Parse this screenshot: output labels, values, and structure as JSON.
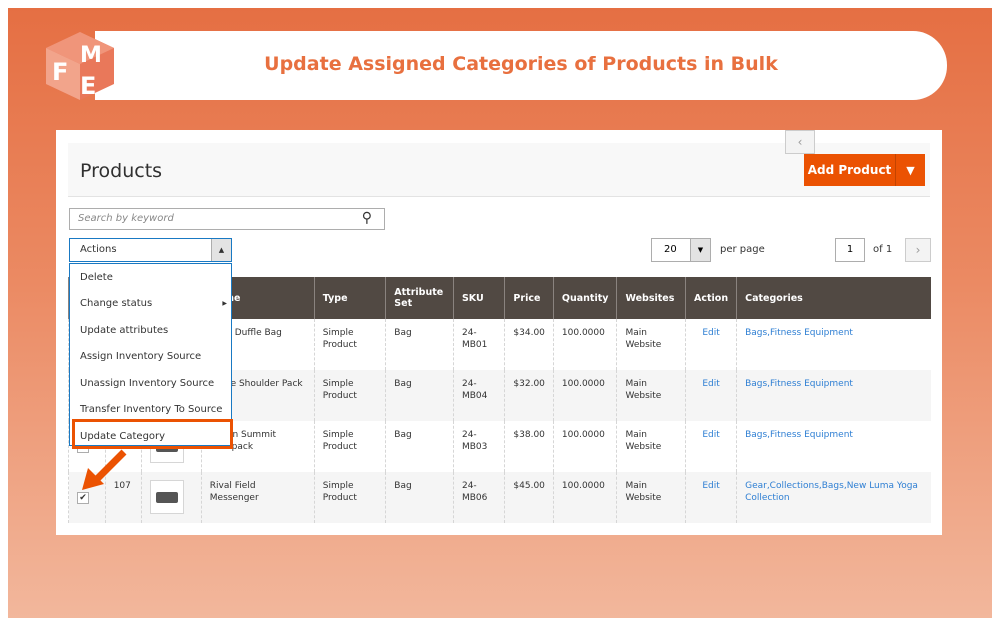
{
  "banner": {
    "title": "Update Assigned Categories of Products in Bulk",
    "logo_text": "FME"
  },
  "page": {
    "title": "Products",
    "add_product": "Add Product"
  },
  "search": {
    "placeholder": "Search by keyword"
  },
  "actions": {
    "label": "Actions",
    "items": [
      "Delete",
      "Change status",
      "Update attributes",
      "Assign Inventory Source",
      "Unassign Inventory Source",
      "Transfer Inventory To Source",
      "Update Category"
    ],
    "highlighted": "Update Category"
  },
  "pager": {
    "per_page_value": "20",
    "per_page_label": "per page",
    "page": "1",
    "of": "of 1"
  },
  "table": {
    "headers": [
      "",
      "",
      "",
      "Name",
      "Type",
      "Attribute Set",
      "SKU",
      "Price",
      "Quantity",
      "Websites",
      "Action",
      "Categories"
    ],
    "rows": [
      {
        "checked": false,
        "id": "",
        "name": "Joust Duffle Bag",
        "type": "Simple Product",
        "attr": "Bag",
        "sku": "24-MB01",
        "price": "$34.00",
        "qty": "100.0000",
        "web": "Main Website",
        "action": "Edit",
        "cat": "Bags,Fitness Equipment"
      },
      {
        "checked": false,
        "id": "",
        "name": "Strive Shoulder Pack",
        "type": "Simple Product",
        "attr": "Bag",
        "sku": "24-MB04",
        "price": "$32.00",
        "qty": "100.0000",
        "web": "Main Website",
        "action": "Edit",
        "cat": "Bags,Fitness Equipment"
      },
      {
        "checked": false,
        "id": "",
        "name": "Crown Summit Backpack",
        "type": "Simple Product",
        "attr": "Bag",
        "sku": "24-MB03",
        "price": "$38.00",
        "qty": "100.0000",
        "web": "Main Website",
        "action": "Edit",
        "cat": "Bags,Fitness Equipment"
      },
      {
        "checked": true,
        "id": "107",
        "name": "Rival Field Messenger",
        "type": "Simple Product",
        "attr": "Bag",
        "sku": "24-MB06",
        "price": "$45.00",
        "qty": "100.0000",
        "web": "Main Website",
        "action": "Edit",
        "cat": "Gear,Collections,Bags,New Luma Yoga Collection"
      }
    ]
  },
  "colors": {
    "accent": "#eb5202",
    "header": "#514943",
    "link": "#2f7fd3",
    "banner_text": "#e8703f"
  }
}
